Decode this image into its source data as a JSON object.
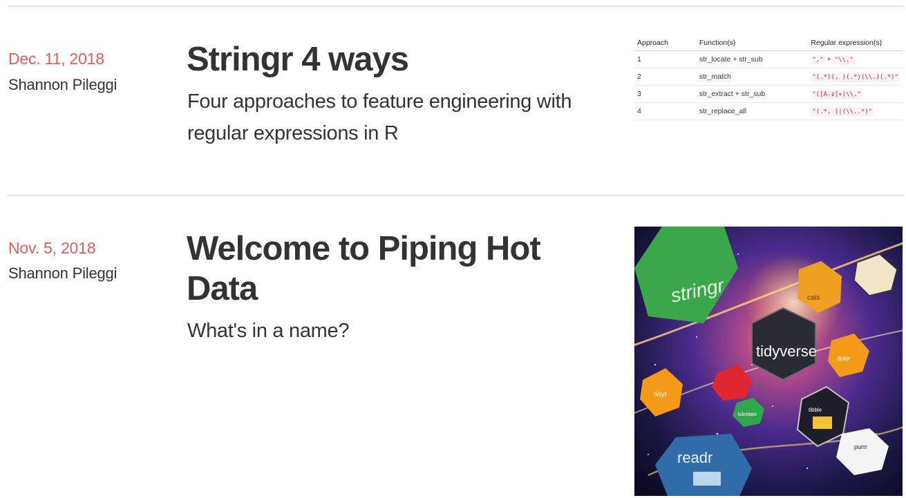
{
  "posts": [
    {
      "date": "Dec. 11, 2018",
      "author": "Shannon Pileggi",
      "title": "Stringr 4 ways",
      "subtitle_line1": "Four approaches to feature engineering with",
      "subtitle_line2": "regular expressions in R",
      "thumbnail_table": {
        "headers": [
          "Approach",
          "Function(s)",
          "Regular expression(s)"
        ],
        "rows": [
          {
            "approach": "1",
            "functions": "str_locate + str_sub",
            "regex_a": "\",\"",
            "plus": "+",
            "regex_b": "\"\\\\.\""
          },
          {
            "approach": "2",
            "functions": "str_match",
            "regex_a": "\"(.*)(, )(.*)(\\\\.)(.*)\"",
            "plus": "",
            "regex_b": ""
          },
          {
            "approach": "3",
            "functions": "str_extract + str_sub",
            "regex_a": "\"([A-z]+)\\\\.\"",
            "plus": "",
            "regex_b": ""
          },
          {
            "approach": "4",
            "functions": "str_replace_all",
            "regex_a": "\"(.*, )|(\\\\..*)\"",
            "plus": "",
            "regex_b": ""
          }
        ]
      }
    },
    {
      "date": "Nov. 5, 2018",
      "author": "Shannon Pileggi",
      "title_line1": "Welcome to Piping Hot",
      "title_line2": "Data",
      "subtitle": "What's in a name?",
      "artwork": {
        "hex_stickers": [
          "stringr",
          "cats",
          "tidyverse",
          "dplyr",
          "tidyr",
          "lubridate",
          "readr",
          "tibble",
          "purrr"
        ]
      }
    }
  ],
  "colors": {
    "date": "#e8595b",
    "text": "#333333",
    "divider": "#e6e6e6",
    "code": "#c7254e"
  }
}
